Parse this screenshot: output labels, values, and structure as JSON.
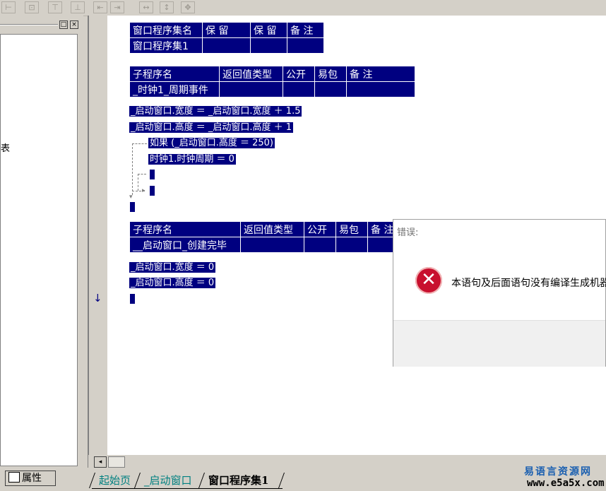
{
  "toolbar": {
    "icons": [
      "align-left-icon",
      "align-center-icon",
      "align-top-icon",
      "align-middle-icon",
      "same-width-icon",
      "same-height-icon",
      "h-space-icon",
      "v-space-icon",
      "center-icon"
    ]
  },
  "left_panel": {
    "minimize_glyph": "□",
    "close_glyph": "×",
    "visible_fragment": "表",
    "props_tab_label": "属性"
  },
  "editor": {
    "assembly_table": {
      "headers": [
        "窗口程序集名",
        "保 留",
        "保 留",
        "备 注"
      ],
      "row": [
        "窗口程序集1",
        "",
        "",
        ""
      ]
    },
    "sub1_table": {
      "headers": [
        "子程序名",
        "返回值类型",
        "公开",
        "易包",
        "备 注"
      ],
      "row": [
        "_时钟1_周期事件",
        "",
        "",
        "",
        ""
      ]
    },
    "sub1_code": [
      "_启动窗口.宽度 ＝ _启动窗口.宽度 ＋ 1.5",
      "_启动窗口.高度 ＝ _启动窗口.高度 ＋ 1",
      "如果 (_启动窗口.高度 ＝ 250)",
      "时钟1.时钟周期 ＝ 0"
    ],
    "sub2_table": {
      "headers": [
        "子程序名",
        "返回值类型",
        "公开",
        "易包",
        "备 注"
      ],
      "row": [
        "__启动窗口_创建完毕",
        "",
        "",
        "",
        ""
      ]
    },
    "sub2_code": [
      "_启动窗口.宽度 ＝ 0",
      "_启动窗口.高度 ＝ 0"
    ],
    "current_line_marker": "↓"
  },
  "dialog": {
    "title": "错误:",
    "icon": "error-icon",
    "icon_glyph": "✕",
    "message": "本语句及后面语句没有编译生成机器"
  },
  "tabs": [
    "起始页",
    "_启动窗口",
    "窗口程序集1"
  ],
  "active_tab": "窗口程序集1",
  "scroll": {
    "left_glyph": "◂"
  },
  "watermark": {
    "line1": "易语言资源网",
    "line2": "www.e5a5x.com"
  },
  "colors": {
    "code_bg": "#000080",
    "code_fg": "#ffffff",
    "error_red": "#c8102e",
    "tab_teal": "#008080"
  }
}
